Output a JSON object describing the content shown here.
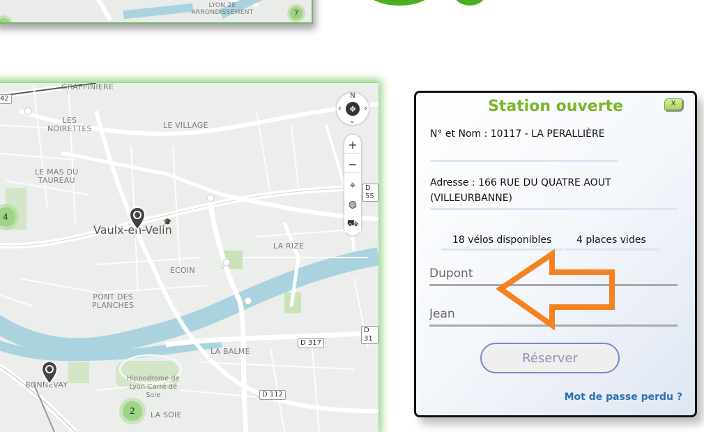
{
  "top_map": {
    "district_label": "LYON 2E\nARRONDISSEMENT",
    "cluster_right": "7"
  },
  "map": {
    "labels": {
      "grappiniere": "GRAPPINIERE",
      "les_noirettes": "LES\nNOIRETTES",
      "le_village": "LE VILLAGE",
      "le_mas_du_taureau": "LE MAS DU\nTAUREAU",
      "vaulx_en_velin": "Vaulx-en-Velin",
      "la_rize": "LA RIZE",
      "ecoin": "ECOIN",
      "pont_des_planches": "PONT DES\nPLANCHES",
      "la_balme": "LA BALME",
      "bonnevay": "BONNEVAY",
      "hippodrome": "Hippodrome de\nLyon-Carré de\nSoie",
      "la_soie": "LA SOIE"
    },
    "road_tags": {
      "r42": "42",
      "d55": "D 55",
      "d31": "D 31",
      "d317": "D 317",
      "d112": "D 112"
    },
    "clusters": {
      "left": "4",
      "bottom": "2"
    },
    "compass_n": "N",
    "controls": {
      "zoom_in": "+",
      "zoom_out": "−"
    }
  },
  "panel": {
    "title": "Station ouverte",
    "close_label": "X",
    "station_line": "N° et Nom : 10117 - LA PERALLIÈRE",
    "address_line1": "Adresse : 166 RUE DU QUATRE AOUT",
    "address_line2": "(VILLEURBANNE)",
    "bikes_available": "18 vélos disponibles",
    "empty_slots": "4 places vides",
    "last_name_placeholder": "Dupont",
    "first_name_placeholder": "Jean",
    "reserve_label": "Réserver",
    "forgot_password": "Mot de passe perdu ?"
  },
  "colors": {
    "title_green": "#7ab52a",
    "arrow_orange": "#f58220",
    "link_blue": "#2a6fb6",
    "map_glow": "#8fcf7d"
  }
}
